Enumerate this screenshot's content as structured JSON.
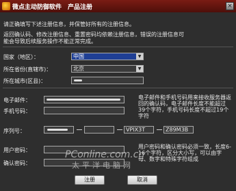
{
  "window": {
    "title": "微点主动防御软件　产品注册"
  },
  "intro": {
    "line1": "请正确填写下述注册信息，并保管好所有的注册信息。",
    "line2": "返回确认码、修改注册信息、重置密码均依赖注册信息，错误的注册信息可",
    "line3": "能会导致后续服务操作不能正常完成。"
  },
  "form": {
    "country_label": "国家（地区）：",
    "country_value": "中国",
    "province_label": "所在省份(直辖市)：",
    "province_value": "北京",
    "city_label": "所在城市(区县)：",
    "email_label": "电子邮件：",
    "phone_label": "手机号码：",
    "email_note": "电子邮件和手机号码用来接收服务器返回的确认码，电子邮件长度不能超过39个字符，手机号码长度不超过19个字符",
    "serial_label": "序列号：",
    "serial_part3": "VPIX3T",
    "serial_part4": "Z89M3B",
    "password_label": "用户密码：",
    "confirm_label": "确认密码：",
    "password_note": "用户密码和确认密码必须一致，长度6-16个字符，区分大小写，可以由字母、数字和特殊字符组成"
  },
  "buttons": {
    "register": "注册",
    "cancel": "取消"
  },
  "watermark": {
    "site": "PConline.com.cn",
    "cn": "太平洋电脑网"
  }
}
